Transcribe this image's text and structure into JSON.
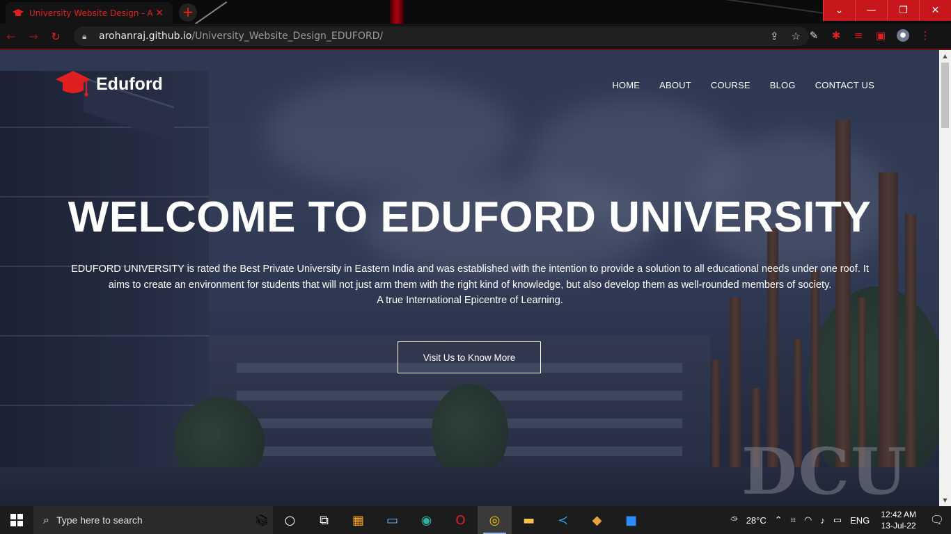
{
  "browser": {
    "tab_title": "University Website Design - A.D.",
    "tab_close": "✕",
    "new_tab": "+",
    "url_host": "arohanraj.github.io",
    "url_path": "/University_Website_Design_EDUFORD/",
    "window_controls": [
      "⌄",
      "—",
      "❐",
      "✕"
    ]
  },
  "site": {
    "brand": "Eduford",
    "nav": [
      "HOME",
      "ABOUT",
      "COURSE",
      "BLOG",
      "CONTACT US"
    ],
    "hero_title": "WELCOME TO EDUFORD UNIVERSITY",
    "hero_line1": "EDUFORD UNIVERSITY is rated the Best Private University in Eastern India and was established with the intention to provide a solution to all educational needs under one roof. It",
    "hero_line2": "aims to create an environment for students that will not just arm them with the right kind of knowledge, but also develop them as well-rounded members of society.",
    "hero_line3": "A true International Epicentre of Learning.",
    "cta_label": "Visit Us to Know More",
    "background_sign": "DCU"
  },
  "taskbar": {
    "search_placeholder": "Type here to search",
    "weather": "28°C",
    "language": "ENG",
    "time": "12:42 AM",
    "date": "13-Jul-22"
  },
  "colors": {
    "accent_red": "#e02020",
    "window_red": "#c8161d",
    "taskbar": "#1c1c1c"
  }
}
